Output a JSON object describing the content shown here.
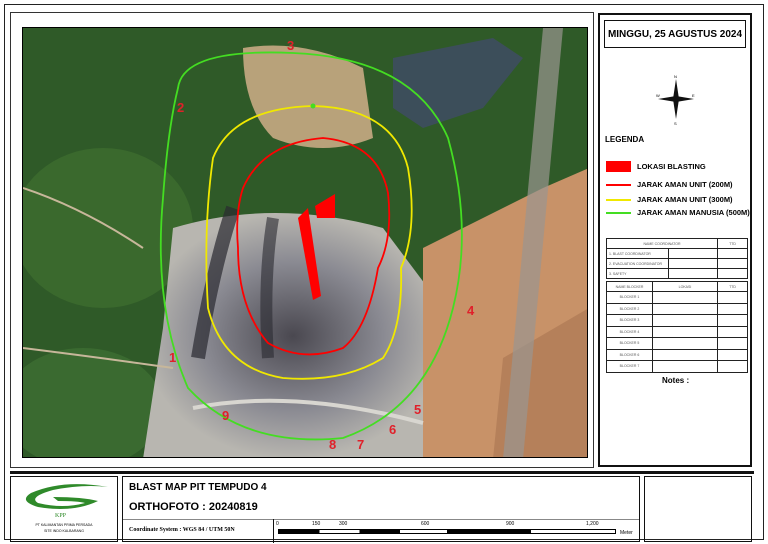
{
  "date": "MINGGU, 25 AGUSTUS 2024",
  "compass": {
    "n": "N",
    "s": "S",
    "e": "E",
    "w": "W"
  },
  "legend": {
    "title": "LEGENDA",
    "items": [
      {
        "label": "LOKASI BLASTING",
        "color": "#ff0000",
        "kind": "fill"
      },
      {
        "label": "JARAK AMAN UNIT (200M)",
        "color": "#ff0000",
        "kind": "line"
      },
      {
        "label": "JARAK AMAN UNIT (300M)",
        "color": "#f0e800",
        "kind": "line"
      },
      {
        "label": "JARAK AMAN MANUSIA (500M)",
        "color": "#44dd22",
        "kind": "line"
      }
    ]
  },
  "coordinator_table": {
    "headers": [
      "NAME COORDINATOR",
      "TTD"
    ],
    "rows": [
      "1. BLAST COORDINATOR",
      "2. EVACUATION COORDINATOR",
      "3. SAFETY"
    ]
  },
  "blocker_table": {
    "headers": [
      "NAME BLOCKER",
      "LOKASI",
      "TTD"
    ],
    "rows": [
      "BLOCKER 1",
      "BLOCKER 2",
      "BLOCKER 3",
      "BLOCKER 4",
      "BLOCKER 5",
      "BLOCKER 6",
      "BLOCKER 7"
    ]
  },
  "notes_label": "Notes :",
  "map_points": [
    "1",
    "2",
    "3",
    "4",
    "5",
    "6",
    "7",
    "8",
    "9"
  ],
  "title": "BLAST MAP PIT TEMPUDO 4",
  "orthofoto": "ORTHOFOTO : 20240819",
  "coordinate_system": "Coordinate System : WGS 84 / UTM 50N",
  "scale": {
    "ticks": [
      "0",
      "150",
      "300",
      "600",
      "900",
      "1,200"
    ],
    "unit": "Meter"
  },
  "logo": {
    "text": "KPP",
    "company": "PT KALIMANTAN PRIMA PERSADA",
    "site": "SITE INDO KALBARANG"
  }
}
